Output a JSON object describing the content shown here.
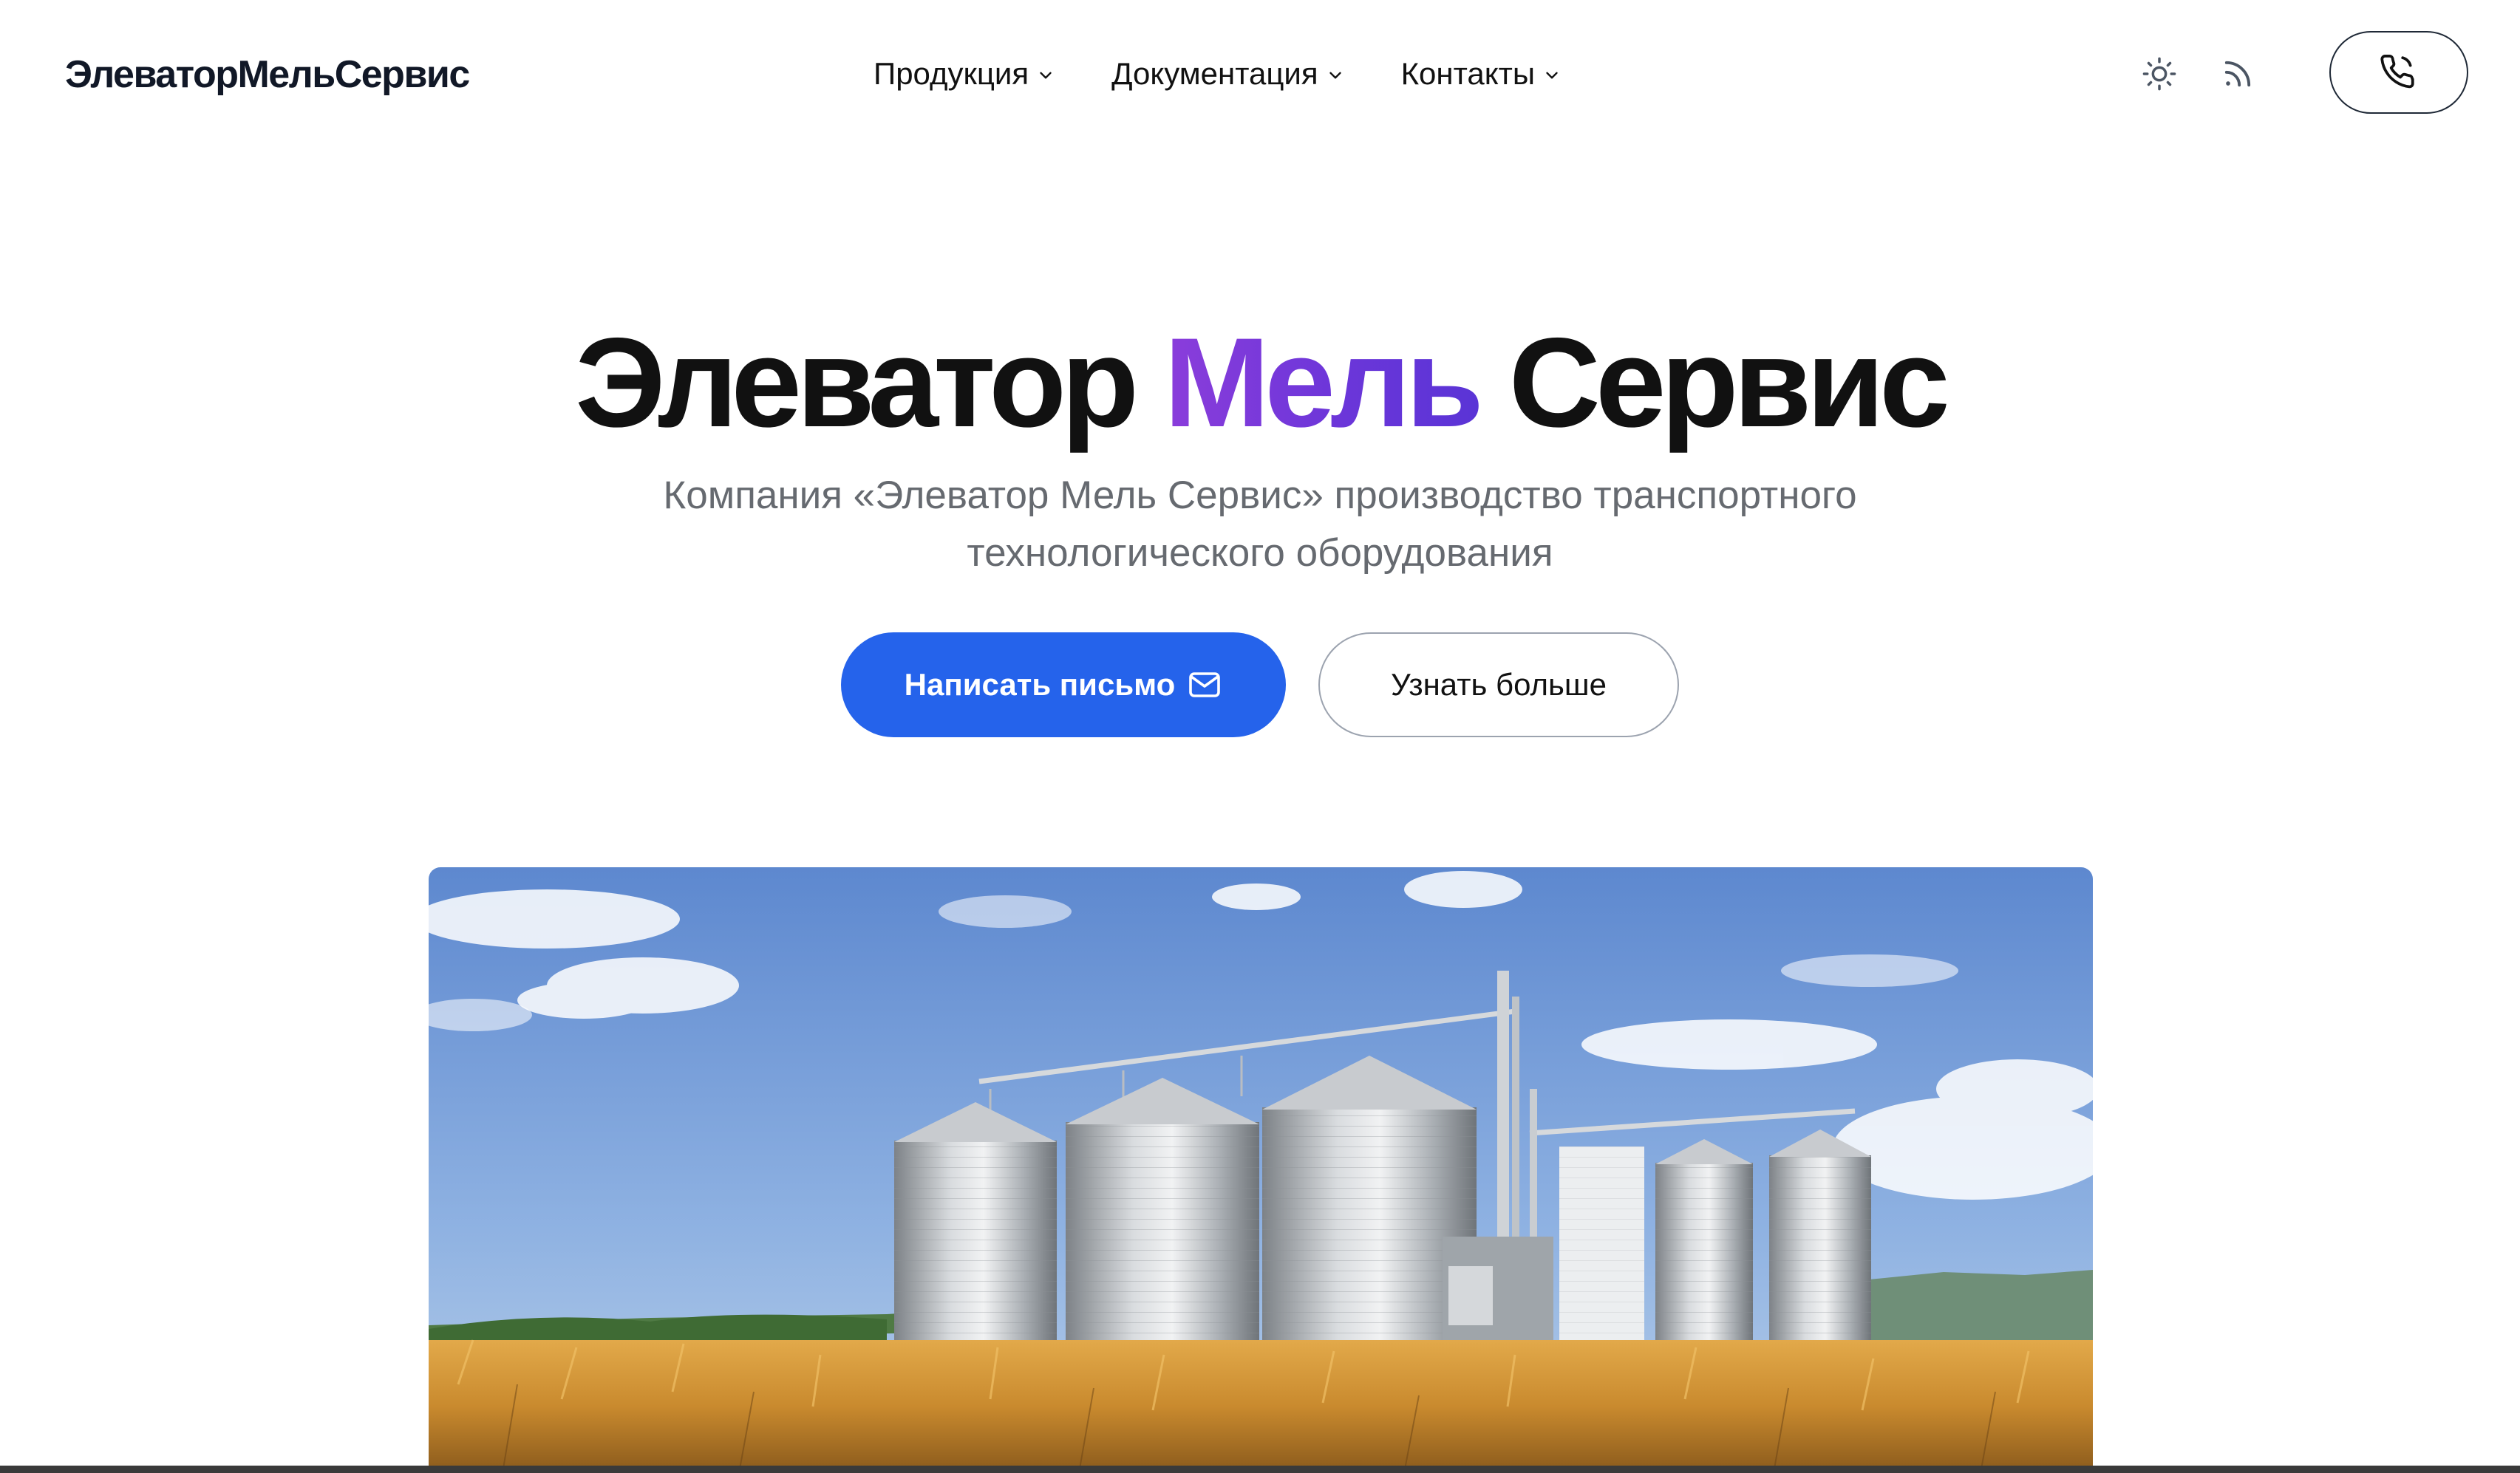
{
  "header": {
    "logo": "ЭлеваторМельСервис",
    "nav": [
      {
        "label": "Продукция"
      },
      {
        "label": "Документация"
      },
      {
        "label": "Контакты"
      }
    ],
    "icons": [
      "sun-icon",
      "rss-icon",
      "phone-icon"
    ]
  },
  "hero": {
    "title_part1": "Элеватор ",
    "title_accent": "Мель",
    "title_part2": " Сервис",
    "subtitle": "Компания «Элеватор Мель Сервис» производство транспортного технологического оборудования",
    "primary_button": "Написать письмо",
    "secondary_button": "Узнать больше"
  },
  "colors": {
    "accent_gradient_start": "#8b3ddb",
    "accent_gradient_end": "#5a34d6",
    "primary_button": "#2563eb",
    "subtitle_text": "#666a70"
  }
}
